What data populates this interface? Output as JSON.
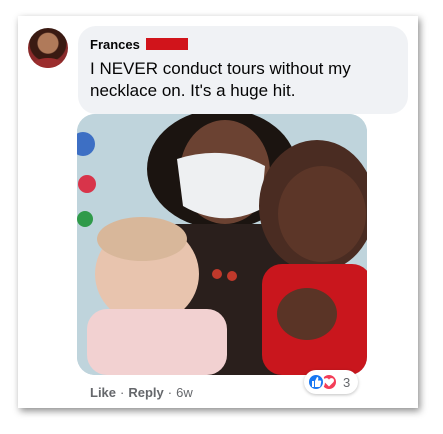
{
  "comment": {
    "author": "Frances",
    "text": "I NEVER conduct tours without my necklace on. It's a huge hit."
  },
  "actions": {
    "like_label": "Like",
    "separator": "·",
    "reply_label": "Reply",
    "time": "6w"
  },
  "reactions": {
    "icons": [
      "like-icon",
      "love-icon"
    ],
    "count": "3",
    "colors": {
      "like": "#1877f2",
      "love": "#f33e58"
    }
  },
  "colors": {
    "bubble": "#f0f2f5",
    "redaction": "#d1141b",
    "secondary_text": "#65676b"
  }
}
